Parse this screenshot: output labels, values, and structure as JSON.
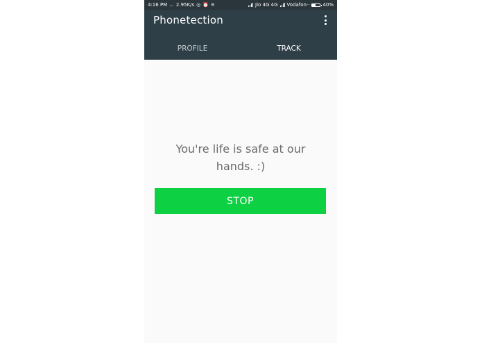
{
  "status_bar": {
    "time": "4:16 PM",
    "dots": "...",
    "speed": "2.95K/s",
    "sim1": "Jio 4G 4G",
    "sim2": "Vodafon··",
    "battery": "40%",
    "battery_level": 0.4
  },
  "app_bar": {
    "title": "Phonetection",
    "background": "#2e3f47"
  },
  "tabs": [
    {
      "label": "PROFILE",
      "active": false
    },
    {
      "label": "TRACK",
      "active": true
    }
  ],
  "main": {
    "message": "You're life is safe at our hands. :)",
    "stop_label": "STOP",
    "stop_color": "#0dd043"
  }
}
